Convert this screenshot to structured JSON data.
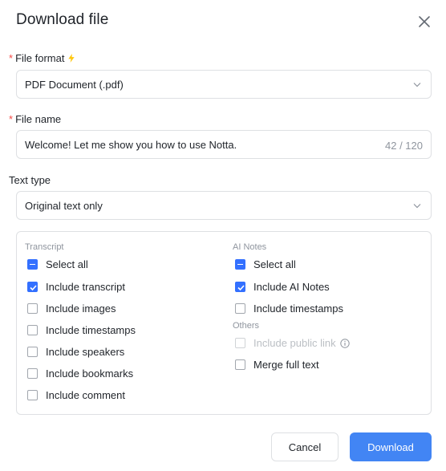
{
  "dialog": {
    "title": "Download file"
  },
  "file_format": {
    "label": "File format",
    "required_mark": "*",
    "value": "PDF Document (.pdf)"
  },
  "file_name": {
    "label": "File name",
    "required_mark": "*",
    "value": "Welcome! Let me show you how to use Notta.",
    "counter": "42 / 120"
  },
  "text_type": {
    "label": "Text type",
    "value": "Original text only"
  },
  "transcript": {
    "heading": "Transcript",
    "items": [
      {
        "label": "Select all",
        "state": "indeterminate"
      },
      {
        "label": "Include transcript",
        "state": "checked"
      },
      {
        "label": "Include images",
        "state": "unchecked"
      },
      {
        "label": "Include timestamps",
        "state": "unchecked"
      },
      {
        "label": "Include speakers",
        "state": "unchecked"
      },
      {
        "label": "Include bookmarks",
        "state": "unchecked"
      },
      {
        "label": "Include comment",
        "state": "unchecked"
      }
    ]
  },
  "ai_notes": {
    "heading": "AI Notes",
    "items": [
      {
        "label": "Select all",
        "state": "indeterminate"
      },
      {
        "label": "Include AI Notes",
        "state": "checked"
      },
      {
        "label": "Include timestamps",
        "state": "unchecked"
      }
    ]
  },
  "others": {
    "heading": "Others",
    "items": [
      {
        "label": "Include public link",
        "state": "disabled"
      },
      {
        "label": "Merge full text",
        "state": "unchecked"
      }
    ]
  },
  "buttons": {
    "cancel": "Cancel",
    "download": "Download"
  },
  "colors": {
    "primary": "#3370ff",
    "download_button": "#4285f4",
    "required": "#f54a45",
    "bolt": "#ffc60a"
  }
}
